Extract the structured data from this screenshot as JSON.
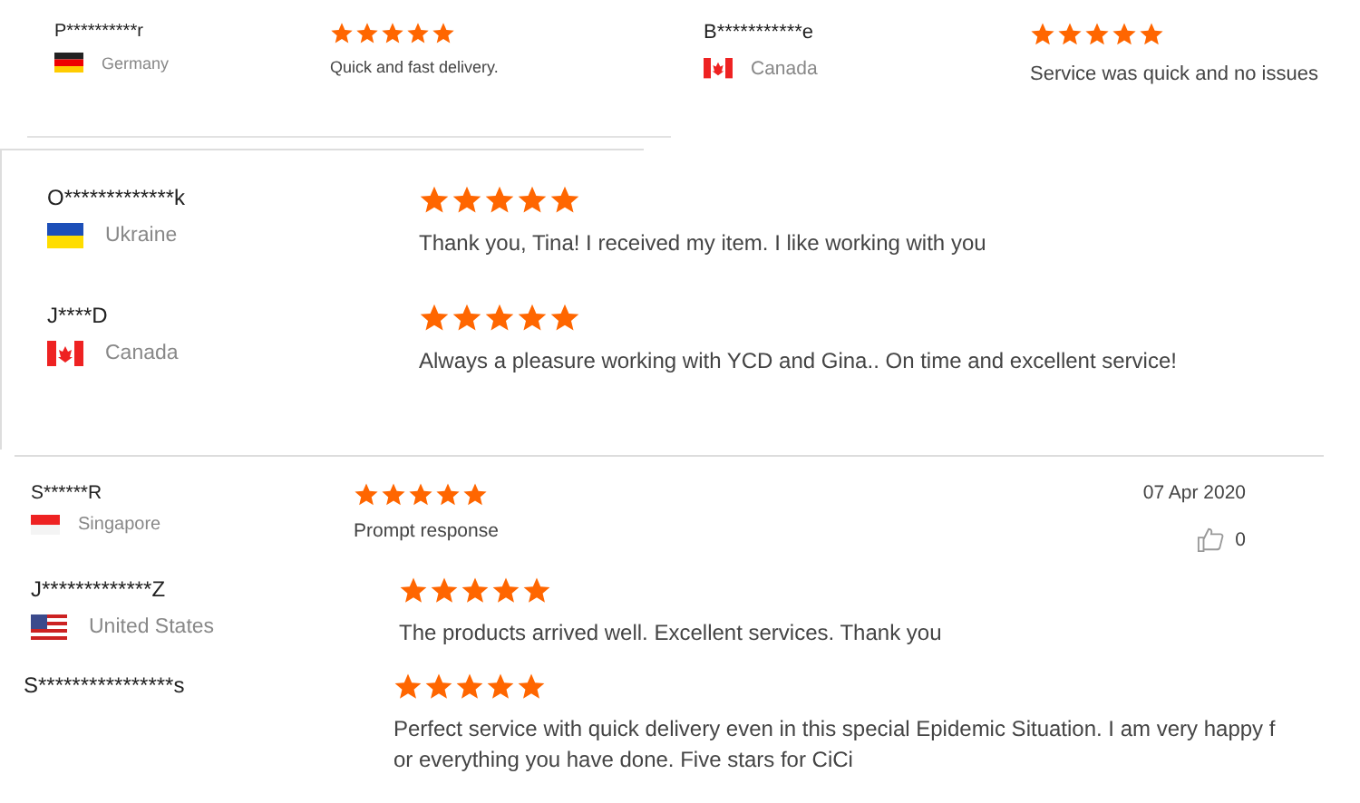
{
  "sections": [
    {
      "reviews": [
        {
          "name": "P**********r",
          "country": "Germany",
          "stars": 5,
          "comment": "Quick and fast delivery."
        },
        {
          "name": "B***********e",
          "country": "Canada",
          "stars": 5,
          "comment": "Service was quick and no issues"
        }
      ]
    },
    {
      "reviews": [
        {
          "name": "O*************k",
          "country": "Ukraine",
          "stars": 5,
          "comment": "Thank you, Tina! I received my item. I like working with you"
        },
        {
          "name": "J****D",
          "country": "Canada",
          "stars": 5,
          "comment": "Always a pleasure working with YCD and Gina.. On time and excellent service!"
        }
      ]
    },
    {
      "reviews": [
        {
          "name": "S******R",
          "country": "Singapore",
          "stars": 5,
          "comment": "Prompt response",
          "date": "07 Apr 2020",
          "likes": "0"
        },
        {
          "name": "J*************Z",
          "country": "United States",
          "stars": 5,
          "comment": "The products arrived well. Excellent services. Thank you"
        },
        {
          "name": "S****************s",
          "stars": 5,
          "comment": "Perfect service with quick delivery even in this special Epidemic Situation. I am very happy f\nor everything you have done. Five stars for CiCi"
        }
      ]
    }
  ]
}
